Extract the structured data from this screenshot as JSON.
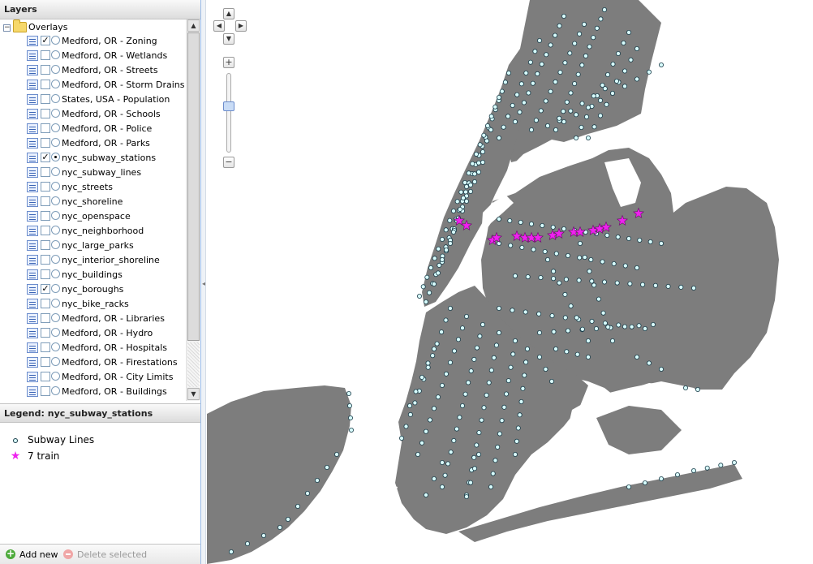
{
  "layers_panel": {
    "title": "Layers",
    "root_label": "Overlays",
    "items": [
      {
        "label": "Medford, OR - Zoning",
        "checked": true,
        "radio": false
      },
      {
        "label": "Medford, OR - Wetlands",
        "checked": false,
        "radio": false
      },
      {
        "label": "Medford, OR - Streets",
        "checked": false,
        "radio": false
      },
      {
        "label": "Medford, OR - Storm Drains",
        "checked": false,
        "radio": false
      },
      {
        "label": "States, USA - Population",
        "checked": false,
        "radio": false
      },
      {
        "label": "Medford, OR - Schools",
        "checked": false,
        "radio": false
      },
      {
        "label": "Medford, OR - Police",
        "checked": false,
        "radio": false
      },
      {
        "label": "Medford, OR - Parks",
        "checked": false,
        "radio": false
      },
      {
        "label": "nyc_subway_stations",
        "checked": true,
        "radio": true
      },
      {
        "label": "nyc_subway_lines",
        "checked": false,
        "radio": false
      },
      {
        "label": "nyc_streets",
        "checked": false,
        "radio": false
      },
      {
        "label": "nyc_shoreline",
        "checked": false,
        "radio": false
      },
      {
        "label": "nyc_openspace",
        "checked": false,
        "radio": false
      },
      {
        "label": "nyc_neighborhood",
        "checked": false,
        "radio": false
      },
      {
        "label": "nyc_large_parks",
        "checked": false,
        "radio": false
      },
      {
        "label": "nyc_interior_shoreline",
        "checked": false,
        "radio": false
      },
      {
        "label": "nyc_buildings",
        "checked": false,
        "radio": false
      },
      {
        "label": "nyc_boroughs",
        "checked": true,
        "radio": false
      },
      {
        "label": "nyc_bike_racks",
        "checked": false,
        "radio": false
      },
      {
        "label": "Medford, OR - Libraries",
        "checked": false,
        "radio": false
      },
      {
        "label": "Medford, OR - Hydro",
        "checked": false,
        "radio": false
      },
      {
        "label": "Medford, OR - Hospitals",
        "checked": false,
        "radio": false
      },
      {
        "label": "Medford, OR - Firestations",
        "checked": false,
        "radio": false
      },
      {
        "label": "Medford, OR - City Limits",
        "checked": false,
        "radio": false
      },
      {
        "label": "Medford, OR - Buildings",
        "checked": false,
        "radio": false
      }
    ]
  },
  "legend": {
    "title": "Legend: nyc_subway_stations",
    "items": [
      {
        "label": "Subway Lines",
        "symbol": "circle-icon",
        "color": "#d8fcfc"
      },
      {
        "label": "7 train",
        "symbol": "star-icon",
        "color": "#ee22ee"
      }
    ]
  },
  "toolbar": {
    "add_label": "Add new",
    "delete_label": "Delete selected"
  },
  "map": {
    "land_color": "#7d7d7d",
    "water_color": "#ffffff",
    "station_fill": "#d8fcfc",
    "station_stroke": "#1a3b48",
    "seven_train_color": "#ee22ee"
  }
}
